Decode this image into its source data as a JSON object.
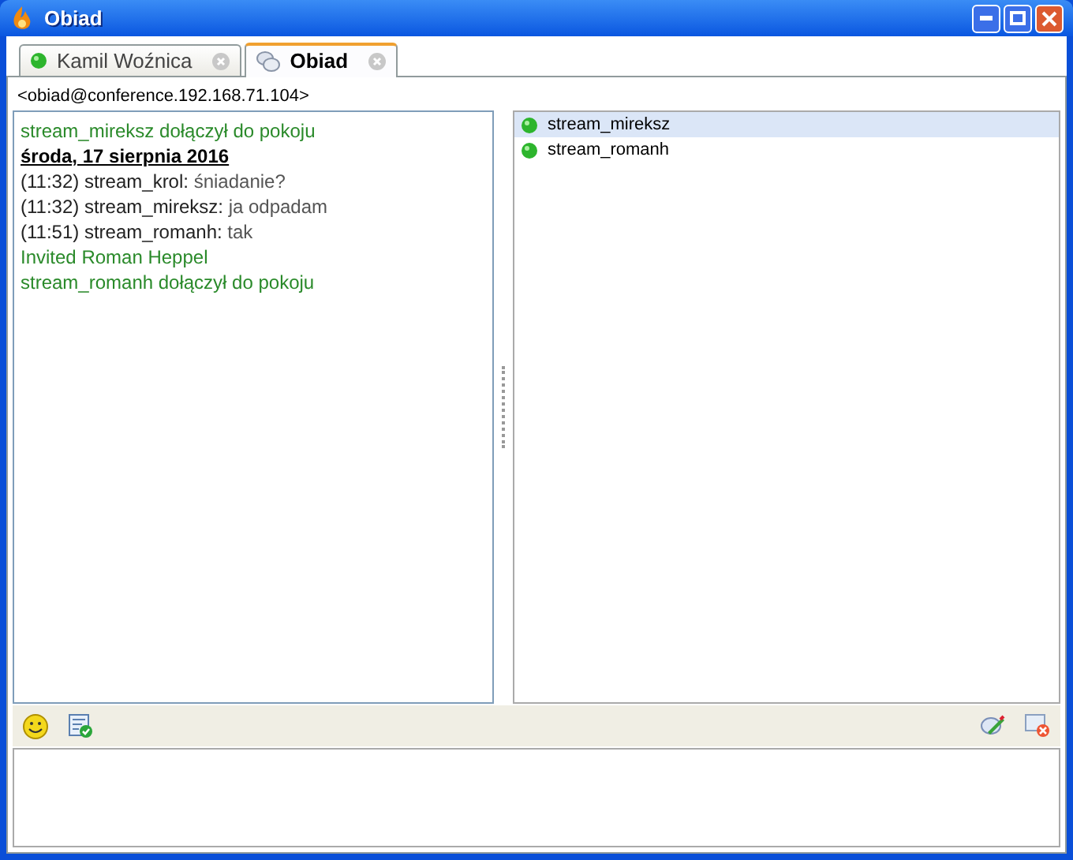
{
  "window": {
    "title": "Obiad"
  },
  "tabs": [
    {
      "label": "Kamil Woźnica",
      "kind": "contact",
      "selected": false
    },
    {
      "label": "Obiad",
      "kind": "room",
      "selected": true
    }
  ],
  "room_address": "<obiad@conference.192.168.71.104>",
  "transcript": [
    {
      "kind": "system",
      "text": "stream_mireksz dołączył do pokoju"
    },
    {
      "kind": "date",
      "text": "środa, 17 sierpnia 2016"
    },
    {
      "kind": "message",
      "time": "(11:32)",
      "sender": "stream_krol:",
      "text": "śniadanie?"
    },
    {
      "kind": "message",
      "time": "(11:32)",
      "sender": "stream_mireksz:",
      "text": "ja odpadam"
    },
    {
      "kind": "message",
      "time": "(11:51)",
      "sender": "stream_romanh:",
      "text": "tak"
    },
    {
      "kind": "system",
      "text": "Invited Roman Heppel"
    },
    {
      "kind": "system",
      "text": "stream_romanh dołączył do pokoju"
    }
  ],
  "participants": [
    {
      "name": "stream_mireksz",
      "selected": true
    },
    {
      "name": "stream_romanh",
      "selected": false
    }
  ]
}
